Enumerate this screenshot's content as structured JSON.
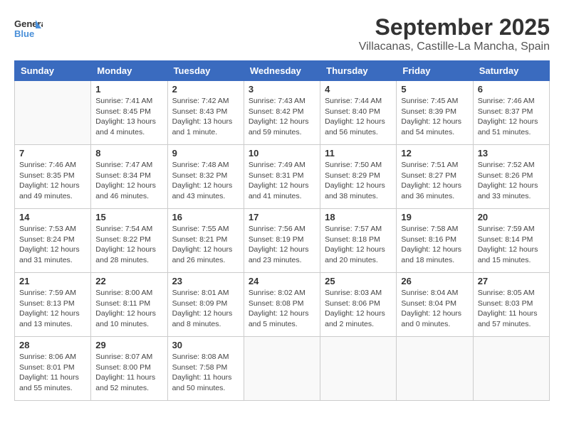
{
  "logo": {
    "line1": "General",
    "line2": "Blue"
  },
  "title": "September 2025",
  "subtitle": "Villacanas, Castille-La Mancha, Spain",
  "days_of_week": [
    "Sunday",
    "Monday",
    "Tuesday",
    "Wednesday",
    "Thursday",
    "Friday",
    "Saturday"
  ],
  "weeks": [
    [
      {
        "day": "",
        "info": ""
      },
      {
        "day": "1",
        "info": "Sunrise: 7:41 AM\nSunset: 8:45 PM\nDaylight: 13 hours\nand 4 minutes."
      },
      {
        "day": "2",
        "info": "Sunrise: 7:42 AM\nSunset: 8:43 PM\nDaylight: 13 hours\nand 1 minute."
      },
      {
        "day": "3",
        "info": "Sunrise: 7:43 AM\nSunset: 8:42 PM\nDaylight: 12 hours\nand 59 minutes."
      },
      {
        "day": "4",
        "info": "Sunrise: 7:44 AM\nSunset: 8:40 PM\nDaylight: 12 hours\nand 56 minutes."
      },
      {
        "day": "5",
        "info": "Sunrise: 7:45 AM\nSunset: 8:39 PM\nDaylight: 12 hours\nand 54 minutes."
      },
      {
        "day": "6",
        "info": "Sunrise: 7:46 AM\nSunset: 8:37 PM\nDaylight: 12 hours\nand 51 minutes."
      }
    ],
    [
      {
        "day": "7",
        "info": "Sunrise: 7:46 AM\nSunset: 8:35 PM\nDaylight: 12 hours\nand 49 minutes."
      },
      {
        "day": "8",
        "info": "Sunrise: 7:47 AM\nSunset: 8:34 PM\nDaylight: 12 hours\nand 46 minutes."
      },
      {
        "day": "9",
        "info": "Sunrise: 7:48 AM\nSunset: 8:32 PM\nDaylight: 12 hours\nand 43 minutes."
      },
      {
        "day": "10",
        "info": "Sunrise: 7:49 AM\nSunset: 8:31 PM\nDaylight: 12 hours\nand 41 minutes."
      },
      {
        "day": "11",
        "info": "Sunrise: 7:50 AM\nSunset: 8:29 PM\nDaylight: 12 hours\nand 38 minutes."
      },
      {
        "day": "12",
        "info": "Sunrise: 7:51 AM\nSunset: 8:27 PM\nDaylight: 12 hours\nand 36 minutes."
      },
      {
        "day": "13",
        "info": "Sunrise: 7:52 AM\nSunset: 8:26 PM\nDaylight: 12 hours\nand 33 minutes."
      }
    ],
    [
      {
        "day": "14",
        "info": "Sunrise: 7:53 AM\nSunset: 8:24 PM\nDaylight: 12 hours\nand 31 minutes."
      },
      {
        "day": "15",
        "info": "Sunrise: 7:54 AM\nSunset: 8:22 PM\nDaylight: 12 hours\nand 28 minutes."
      },
      {
        "day": "16",
        "info": "Sunrise: 7:55 AM\nSunset: 8:21 PM\nDaylight: 12 hours\nand 26 minutes."
      },
      {
        "day": "17",
        "info": "Sunrise: 7:56 AM\nSunset: 8:19 PM\nDaylight: 12 hours\nand 23 minutes."
      },
      {
        "day": "18",
        "info": "Sunrise: 7:57 AM\nSunset: 8:18 PM\nDaylight: 12 hours\nand 20 minutes."
      },
      {
        "day": "19",
        "info": "Sunrise: 7:58 AM\nSunset: 8:16 PM\nDaylight: 12 hours\nand 18 minutes."
      },
      {
        "day": "20",
        "info": "Sunrise: 7:59 AM\nSunset: 8:14 PM\nDaylight: 12 hours\nand 15 minutes."
      }
    ],
    [
      {
        "day": "21",
        "info": "Sunrise: 7:59 AM\nSunset: 8:13 PM\nDaylight: 12 hours\nand 13 minutes."
      },
      {
        "day": "22",
        "info": "Sunrise: 8:00 AM\nSunset: 8:11 PM\nDaylight: 12 hours\nand 10 minutes."
      },
      {
        "day": "23",
        "info": "Sunrise: 8:01 AM\nSunset: 8:09 PM\nDaylight: 12 hours\nand 8 minutes."
      },
      {
        "day": "24",
        "info": "Sunrise: 8:02 AM\nSunset: 8:08 PM\nDaylight: 12 hours\nand 5 minutes."
      },
      {
        "day": "25",
        "info": "Sunrise: 8:03 AM\nSunset: 8:06 PM\nDaylight: 12 hours\nand 2 minutes."
      },
      {
        "day": "26",
        "info": "Sunrise: 8:04 AM\nSunset: 8:04 PM\nDaylight: 12 hours\nand 0 minutes."
      },
      {
        "day": "27",
        "info": "Sunrise: 8:05 AM\nSunset: 8:03 PM\nDaylight: 11 hours\nand 57 minutes."
      }
    ],
    [
      {
        "day": "28",
        "info": "Sunrise: 8:06 AM\nSunset: 8:01 PM\nDaylight: 11 hours\nand 55 minutes."
      },
      {
        "day": "29",
        "info": "Sunrise: 8:07 AM\nSunset: 8:00 PM\nDaylight: 11 hours\nand 52 minutes."
      },
      {
        "day": "30",
        "info": "Sunrise: 8:08 AM\nSunset: 7:58 PM\nDaylight: 11 hours\nand 50 minutes."
      },
      {
        "day": "",
        "info": ""
      },
      {
        "day": "",
        "info": ""
      },
      {
        "day": "",
        "info": ""
      },
      {
        "day": "",
        "info": ""
      }
    ]
  ]
}
